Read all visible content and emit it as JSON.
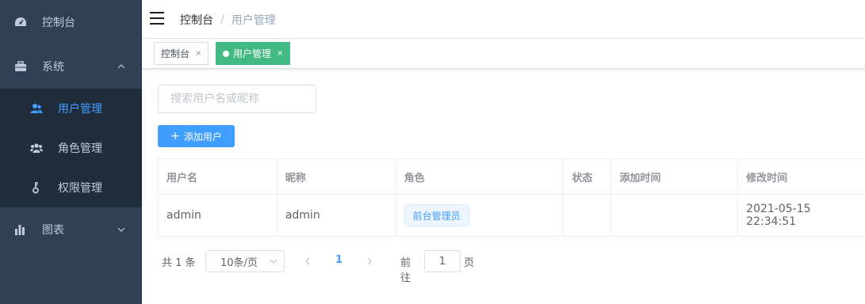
{
  "sidebar": {
    "dashboard_label": "控制台",
    "system_label": "系统",
    "sub_items": [
      {
        "label": "用户管理",
        "active": true
      },
      {
        "label": "角色管理",
        "active": false
      },
      {
        "label": "权限管理",
        "active": false
      }
    ],
    "charts_label": "图表",
    "text_color": "#bfcbd9",
    "active_color": "#409eff",
    "bg_color": "#304156"
  },
  "header": {
    "breadcrumb_home": "控制台",
    "breadcrumb_sep": "/",
    "breadcrumb_current": "用户管理"
  },
  "tags": [
    {
      "label": "控制台",
      "close": "×",
      "active": false
    },
    {
      "label": "用户管理",
      "close": "×",
      "active": true
    }
  ],
  "main": {
    "search_placeholder": "搜索用户名或昵称",
    "search_value": "",
    "add_button_icon": "+",
    "add_button_label": "添加用户",
    "table": {
      "headers": [
        "用户名",
        "昵称",
        "角色",
        "状态",
        "添加时间",
        "修改时间"
      ],
      "rows": [
        {
          "username": "admin",
          "nickname": "admin",
          "role": "前台管理员",
          "status": "",
          "created": "",
          "modified": "2021-05-15 22:34:51"
        }
      ]
    },
    "pagination": {
      "total_text": "共 1 条",
      "page_size": "10条/页",
      "current_page": "1",
      "goto_label": "前往",
      "goto_value": "1",
      "page_suffix": "页"
    }
  }
}
